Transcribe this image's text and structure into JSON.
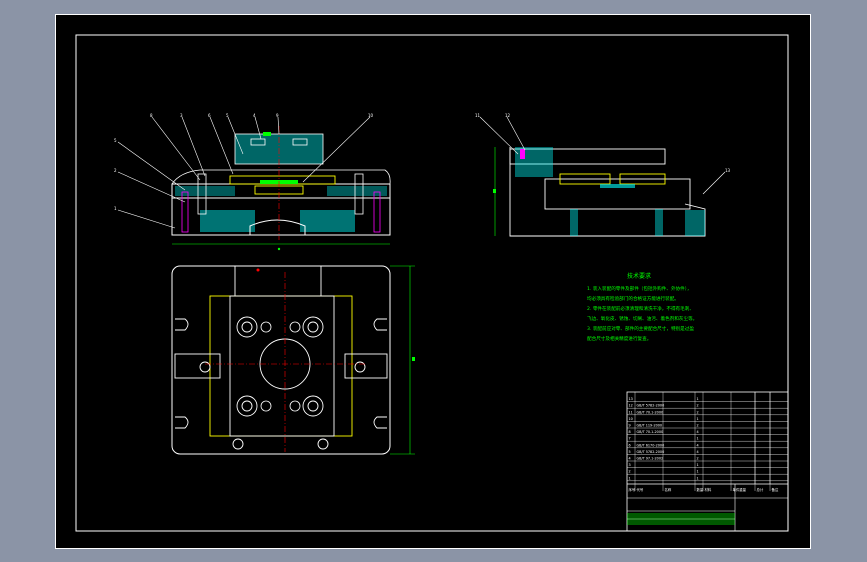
{
  "drawing": {
    "title": "",
    "background_color": "#8b94a6",
    "sheet_color": "#000000",
    "line_colors": {
      "outline": "#ffffff",
      "hidden": "#ffff00",
      "center": "#ff0000",
      "hatch": "#00ffff",
      "dimension": "#00ff00",
      "leader": "#ffffff",
      "fastener": "#ff00ff"
    }
  },
  "views": {
    "front_section": {
      "balloons": [
        "8",
        "3",
        "6",
        "5",
        "4",
        "9",
        "10",
        "5",
        "2",
        "1"
      ]
    },
    "side_view": {
      "balloons": [
        "11",
        "12",
        "13"
      ]
    },
    "top_view": {}
  },
  "technical_requirements": {
    "title": "技术要求",
    "lines": [
      "1. 装入装配的零件及部件（包括外购件、外协件），",
      "   均必须具有检验部门的合格证方能进行装配。",
      "2. 零件在装配前必须清理和清洗干净，不得有毛刺、",
      "   飞边、氧化皮、锈蚀、切屑、油污、着色剂和灰尘等。",
      "3. 装配前应对零、部件的主要配合尺寸，特别是过盈",
      "   配合尺寸及相关精度进行复查。"
    ]
  },
  "title_block": {
    "header": [
      "序号",
      "代号",
      "名称",
      "数量",
      "材料",
      "单件重量",
      "总计",
      "备注"
    ],
    "rows": [
      [
        "13",
        "",
        "",
        "1",
        "",
        "",
        "",
        ""
      ],
      [
        "12",
        "GB/T 5782-2000",
        "",
        "2",
        "",
        "",
        "",
        ""
      ],
      [
        "11",
        "GB/T 70.1-2000",
        "",
        "2",
        "",
        "",
        "",
        ""
      ],
      [
        "10",
        "",
        "",
        "1",
        "",
        "",
        "",
        ""
      ],
      [
        "9",
        "GB/T 119-2000",
        "",
        "2",
        "",
        "",
        "",
        ""
      ],
      [
        "8",
        "GB/T 70.1-2000",
        "",
        "4",
        "",
        "",
        "",
        ""
      ],
      [
        "7",
        "",
        "",
        "1",
        "",
        "",
        "",
        ""
      ],
      [
        "6",
        "GB/T 6170-2000",
        "",
        "4",
        "",
        "",
        "",
        ""
      ],
      [
        "5",
        "GB/T 5782-2000",
        "",
        "4",
        "",
        "",
        "",
        ""
      ],
      [
        "4",
        "GB/T 97.1-2002",
        "",
        "2",
        "",
        "",
        "",
        ""
      ],
      [
        "3",
        "",
        "",
        "1",
        "",
        "",
        "",
        ""
      ],
      [
        "2",
        "",
        "",
        "1",
        "",
        "",
        "",
        ""
      ],
      [
        "1",
        "",
        "",
        "1",
        "",
        "",
        "",
        ""
      ]
    ]
  }
}
